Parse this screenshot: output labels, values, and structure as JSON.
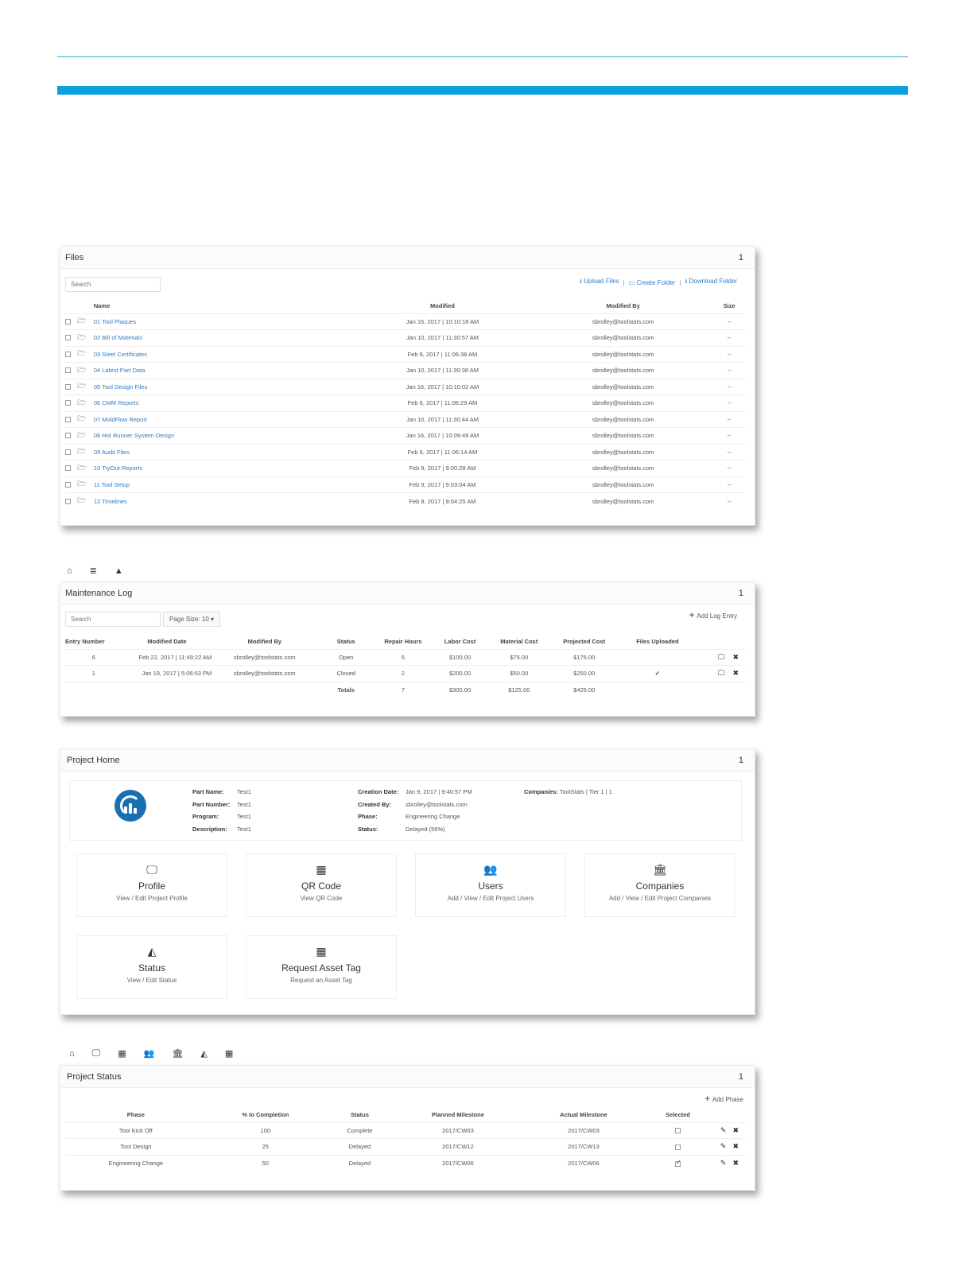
{
  "files": {
    "title": "Files",
    "count": "1",
    "search_placeholder": "Search",
    "actions": {
      "upload": "Upload Files",
      "create": "Create Folder",
      "download": "Download Folder",
      "separator": "|"
    },
    "columns": {
      "name": "Name",
      "modified": "Modified",
      "modified_by": "Modified By",
      "size": "Size"
    },
    "rows": [
      {
        "name": "01 Tool Plaques",
        "modified": "Jan 16, 2017 | 10:10:18 AM",
        "by": "sbrolley@toolstats.com",
        "size": "--"
      },
      {
        "name": "02 Bill of Materials",
        "modified": "Jan 10, 2017 | 11:30:57 AM",
        "by": "sbrolley@toolstats.com",
        "size": "--"
      },
      {
        "name": "03 Steel Certificates",
        "modified": "Feb 6, 2017 | 11:06:38 AM",
        "by": "sbrolley@toolstats.com",
        "size": "--"
      },
      {
        "name": "04 Latest Part Data",
        "modified": "Jan 10, 2017 | 11:30:38 AM",
        "by": "sbrolley@toolstats.com",
        "size": "--"
      },
      {
        "name": "05 Tool Design Files",
        "modified": "Jan 16, 2017 | 10:10:02 AM",
        "by": "sbrolley@toolstats.com",
        "size": "--"
      },
      {
        "name": "06 CMM Reports",
        "modified": "Feb 6, 2017 | 11:06:29 AM",
        "by": "sbrolley@toolstats.com",
        "size": "--"
      },
      {
        "name": "07 MoldFlow Report",
        "modified": "Jan 10, 2017 | 11:30:44 AM",
        "by": "sbrolley@toolstats.com",
        "size": "--"
      },
      {
        "name": "08 Hot Runner System Design",
        "modified": "Jan 16, 2017 | 10:09:49 AM",
        "by": "sbrolley@toolstats.com",
        "size": "--"
      },
      {
        "name": "09 Audit Files",
        "modified": "Feb 6, 2017 | 11:06:14 AM",
        "by": "sbrolley@toolstats.com",
        "size": "--"
      },
      {
        "name": "10 TryOut Reports",
        "modified": "Feb 9, 2017 | 9:00:28 AM",
        "by": "sbrolley@toolstats.com",
        "size": "--"
      },
      {
        "name": "11 Tool Setup",
        "modified": "Feb 9, 2017 | 9:03:04 AM",
        "by": "sbrolley@toolstats.com",
        "size": "--"
      },
      {
        "name": "12 Timelines",
        "modified": "Feb 9, 2017 | 9:04:25 AM",
        "by": "sbrolley@toolstats.com",
        "size": "--"
      }
    ]
  },
  "maintenance": {
    "title": "Maintenance Log",
    "count": "1",
    "search_placeholder": "Search",
    "page_size": "Page Size: 10 ▾",
    "add_label": "Add Log Entry",
    "columns": [
      "Entry Number",
      "Modified Date",
      "Modified By",
      "Status",
      "Repair Hours",
      "Labor Cost",
      "Material Cost",
      "Projected Cost",
      "Files Uploaded"
    ],
    "rows": [
      {
        "entry": "6",
        "date": "Feb 22, 2017 | 11:49:22 AM",
        "by": "sbrolley@toolstats.com",
        "status": "Open",
        "hours": "5",
        "labor": "$100.00",
        "material": "$75.00",
        "projected": "$175.00",
        "files": ""
      },
      {
        "entry": "1",
        "date": "Jan 19, 2017 | 5:06:53 PM",
        "by": "sbrolley@toolstats.com",
        "status": "Closed",
        "hours": "2",
        "labor": "$200.00",
        "material": "$50.00",
        "projected": "$250.00",
        "files": "✔"
      }
    ],
    "totals": {
      "label": "Totals",
      "hours": "7",
      "labor": "$300.00",
      "material": "$125.00",
      "projected": "$425.00"
    }
  },
  "project_home": {
    "title": "Project Home",
    "count": "1",
    "fields_left": [
      {
        "k": "Part Name:",
        "v": "Test1"
      },
      {
        "k": "Part Number:",
        "v": "Test1"
      },
      {
        "k": "Program:",
        "v": "Test1"
      },
      {
        "k": "Description:",
        "v": "Test1"
      }
    ],
    "fields_mid": [
      {
        "k": "Creation Date:",
        "v": "Jan 9, 2017 | 9:40:57 PM"
      },
      {
        "k": "Created By:",
        "v": "sbrolley@toolstats.com"
      },
      {
        "k": "Phase:",
        "v": "Engineering Change"
      },
      {
        "k": "Status:",
        "v": "Delayed (56%)"
      }
    ],
    "companies": {
      "k": "Companies:",
      "v": "ToolStats | Tier 1 | 1"
    },
    "tiles": [
      {
        "icon": "monitor-icon",
        "title": "Profile",
        "desc": "View / Edit Project Profile"
      },
      {
        "icon": "qr-code-icon",
        "title": "QR Code",
        "desc": "View QR Code"
      },
      {
        "icon": "users-icon",
        "title": "Users",
        "desc": "Add / View / Edit Project Users"
      },
      {
        "icon": "bank-icon",
        "title": "Companies",
        "desc": "Add / View / Edit Project Companies"
      },
      {
        "icon": "area-chart-icon",
        "title": "Status",
        "desc": "View / Edit Status"
      },
      {
        "icon": "grid-icon",
        "title": "Request Asset Tag",
        "desc": "Request an Asset Tag"
      }
    ]
  },
  "project_status": {
    "title": "Project Status",
    "count": "1",
    "add_label": "Add Phase",
    "columns": [
      "Phase",
      "% to Completion",
      "Status",
      "Planned Milestone",
      "Actual Milestone",
      "Selected"
    ],
    "rows": [
      {
        "phase": "Tool Kick Off",
        "pct": "100",
        "status": "Complete",
        "planned": "2017/CW03",
        "actual": "2017/CW03",
        "selected": false
      },
      {
        "phase": "Tool Design",
        "pct": "25",
        "status": "Delayed",
        "planned": "2017/CW12",
        "actual": "2017/CW13",
        "selected": false
      },
      {
        "phase": "Engineering Change",
        "pct": "50",
        "status": "Delayed",
        "planned": "2017/CW06",
        "actual": "2017/CW06",
        "selected": true
      }
    ]
  },
  "colors": {
    "accent": "#0aa0dc",
    "link": "#2c7cc6",
    "add_green": "#2e8b2e"
  }
}
